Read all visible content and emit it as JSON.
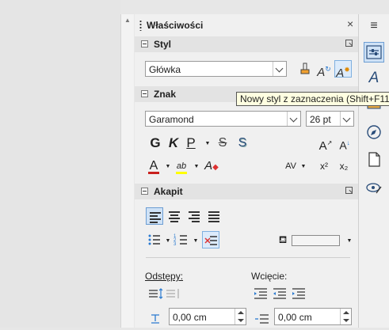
{
  "sidebar": {
    "title": "Właściwości",
    "close_symbol": "×",
    "menu_symbol": "≡"
  },
  "style_section": {
    "title": "Styl",
    "selected_style": "Główka",
    "tooltip": "Nowy styl z zaznaczenia (Shift+F11)"
  },
  "char_section": {
    "title": "Znak",
    "font_name": "Garamond",
    "font_size": "26 pt",
    "bold": "G",
    "italic": "K",
    "underline": "P",
    "strike": "S",
    "shadow": "S",
    "grow": "A",
    "shrink": "A",
    "font_color": "A",
    "highlight": "ab",
    "clear": "A",
    "spacing": "AV",
    "superscript": "x²",
    "subscript": "x₂"
  },
  "para_section": {
    "title": "Akapit",
    "spacing_label": "Odstępy:",
    "indent_label": "Wcięcie:",
    "above_spacing": "0,00 cm",
    "before_indent": "0,00 cm"
  },
  "colors": {
    "font_color": "#c9211e",
    "highlight_color": "#ffff00",
    "accent": "#2a4d7a"
  },
  "tabs": [
    "properties-icon",
    "styles-icon",
    "gallery-icon",
    "navigator-icon",
    "page-icon",
    "inspector-icon"
  ]
}
